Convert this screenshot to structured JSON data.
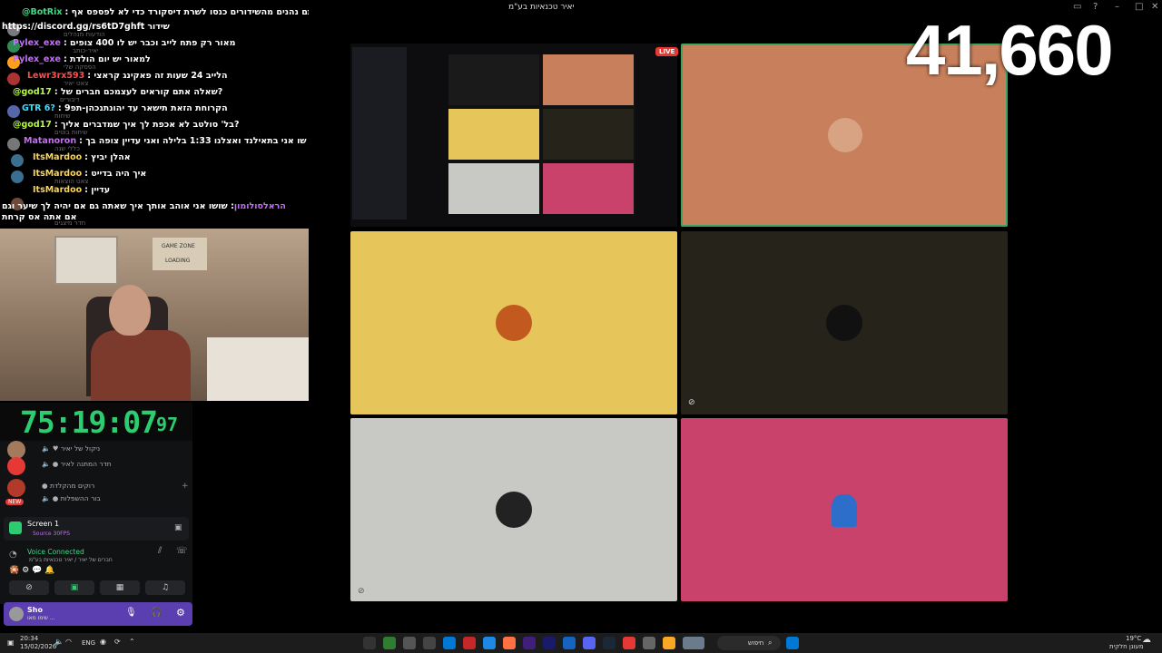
{
  "window": {
    "title": "יאיר טכנאיות בע\"מ"
  },
  "chat": [
    {
      "user": "@BotRix",
      "text": ": אם אתם נהנים מהשידורים כנסו לשרת דיסקורד כדי לא לפספס אף",
      "color": "#3ddc84"
    },
    {
      "user": "https://discord.gg/rs6tD7ghft",
      "text": "שידור",
      "color": "#ffffff"
    },
    {
      "user": "Pylex_exe",
      "text": ": מאור רק פתח לייב וכבר יש לו 400 צופים",
      "color": "#c86bff"
    },
    {
      "user": "Pylex_exe",
      "text": ": למאור יש יום הולדת",
      "color": "#c86bff"
    },
    {
      "user": "Lewr3rx593",
      "text": ": הלייב 24 שעות זה פאקינג קראצי",
      "color": "#ff4d4d"
    },
    {
      "user": "@god17",
      "text": ": שאלה אתם קוראים לעצמכם חברים של?",
      "color": "#b4ff3c"
    },
    {
      "user": "GTR 6?",
      "text": ": הקרוחת הזאת תישאר עד יהונתנכהן-תפ9",
      "color": "#3ddcff"
    },
    {
      "user": "@god17",
      "text": ": בל' סולטב לא אכפת לך איך שמדברים אליך?",
      "color": "#b4ff3c"
    },
    {
      "user": "Matanoron",
      "text": ": שו אני בתאילנד ואצלנו 1:33 בלילה ואני עדיין צופה בך",
      "color": "#c86bff"
    },
    {
      "user": "ItsMardoo",
      "text": ": אהלן יביץ",
      "color": "#ffd54f"
    },
    {
      "user": "ItsMardoo",
      "text": ": איך היה בדייט",
      "color": "#ffd54f"
    },
    {
      "user": "ItsMardoo",
      "text": ": עדיין",
      "color": "#ffd54f"
    },
    {
      "user": "הראלסולומון",
      "text": ": שושו אני אוהב אותך איך שאתה גם אם יהיה לך שיער וגם אם אתה אס קרחת",
      "color": "#c86bff"
    }
  ],
  "chat_ghost_labels": [
    "הודעות מנהלים",
    "יאיר-כותב",
    "הפסקה שלי",
    "צאט יאיר",
    "דיבורים",
    "שיחות",
    "שיחות בוטים",
    "כללי שנה",
    "צאט הוצאות",
    "חדר מיצגים"
  ],
  "timer": {
    "main": "75:19:07",
    "frac": "97"
  },
  "game_zone": {
    "line1": "GAME ZONE",
    "line2": "LOADING"
  },
  "discord": {
    "channels": [
      "ניקול של יאיר",
      "חדר המתנה לאיר",
      "רוקים מהקלדת",
      "בור ההשפלות"
    ],
    "new_badge": "NEW",
    "screen": {
      "title": "Screen 1",
      "subtitle": "Source 30FPS"
    },
    "voice": {
      "status": "Voice Connected",
      "channel": "חברים של יאיר / יאיר טכנאיות בע\"מ"
    },
    "user": {
      "name": "Sho",
      "status": "שימו מאו ..."
    }
  },
  "call": {
    "live_label": "LIVE",
    "tiles": [
      {
        "name": "tile-screenshare",
        "color": "#0d0d0f"
      },
      {
        "name": "tile-orange",
        "color": "#c8805c",
        "avatar": "#d7a383"
      },
      {
        "name": "tile-yellow",
        "color": "#e6c55a",
        "avatar": "#c25a1f"
      },
      {
        "name": "tile-dark",
        "color": "#26231a",
        "avatar": "#111111"
      },
      {
        "name": "tile-grey",
        "color": "#c8c8c4",
        "avatar": "#222222"
      },
      {
        "name": "tile-pink",
        "color": "#c8426c",
        "avatar": "#2c6ec9"
      }
    ]
  },
  "viewer_count": "41,660",
  "taskbar": {
    "search": "חיפוש",
    "time": "20:34",
    "date": "15/02/2026",
    "lang": "ENG",
    "weather": "19°C",
    "weather_desc": "מעונן חלקית"
  }
}
